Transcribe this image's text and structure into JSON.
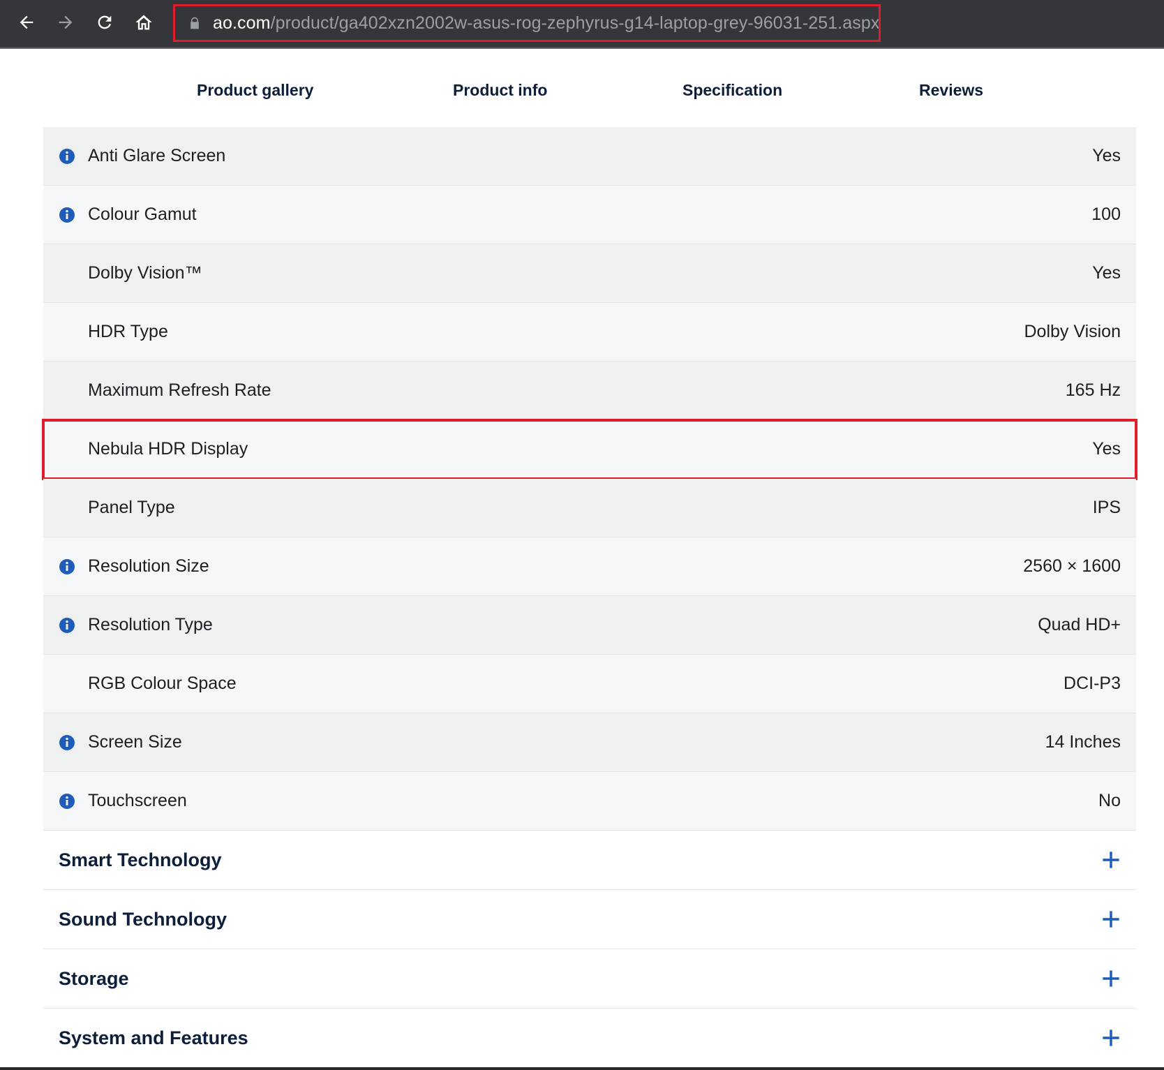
{
  "browser": {
    "url_host": "ao.com",
    "url_path": "/product/ga402xzn2002w-asus-rog-zephyrus-g14-laptop-grey-96031-251.aspx",
    "icons": [
      "back-icon",
      "forward-icon",
      "reload-icon",
      "home-icon",
      "lock-icon"
    ]
  },
  "tabs": [
    {
      "label": "Product gallery"
    },
    {
      "label": "Product info"
    },
    {
      "label": "Specification"
    },
    {
      "label": "Reviews"
    }
  ],
  "specs": [
    {
      "label": "Anti Glare Screen",
      "value": "Yes",
      "info": true
    },
    {
      "label": "Colour Gamut",
      "value": "100",
      "info": true
    },
    {
      "label": "Dolby Vision™",
      "value": "Yes",
      "info": false
    },
    {
      "label": "HDR Type",
      "value": "Dolby Vision",
      "info": false
    },
    {
      "label": "Maximum Refresh Rate",
      "value": "165 Hz",
      "info": false
    },
    {
      "label": "Nebula HDR Display",
      "value": "Yes",
      "info": false,
      "highlighted": true
    },
    {
      "label": "Panel Type",
      "value": "IPS",
      "info": false
    },
    {
      "label": "Resolution Size",
      "value": "2560 × 1600",
      "info": true
    },
    {
      "label": "Resolution Type",
      "value": "Quad HD+",
      "info": true
    },
    {
      "label": "RGB Colour Space",
      "value": "DCI-P3",
      "info": false
    },
    {
      "label": "Screen Size",
      "value": "14 Inches",
      "info": true
    },
    {
      "label": "Touchscreen",
      "value": "No",
      "info": true
    }
  ],
  "sections": [
    {
      "title": "Smart Technology"
    },
    {
      "title": "Sound Technology"
    },
    {
      "title": "Storage"
    },
    {
      "title": "System and Features"
    }
  ],
  "colors": {
    "accent_blue": "#1f5bb8",
    "highlight_red": "#e01e2b",
    "heading_navy": "#0d1e3b",
    "toolbar_bg": "#35363a"
  }
}
